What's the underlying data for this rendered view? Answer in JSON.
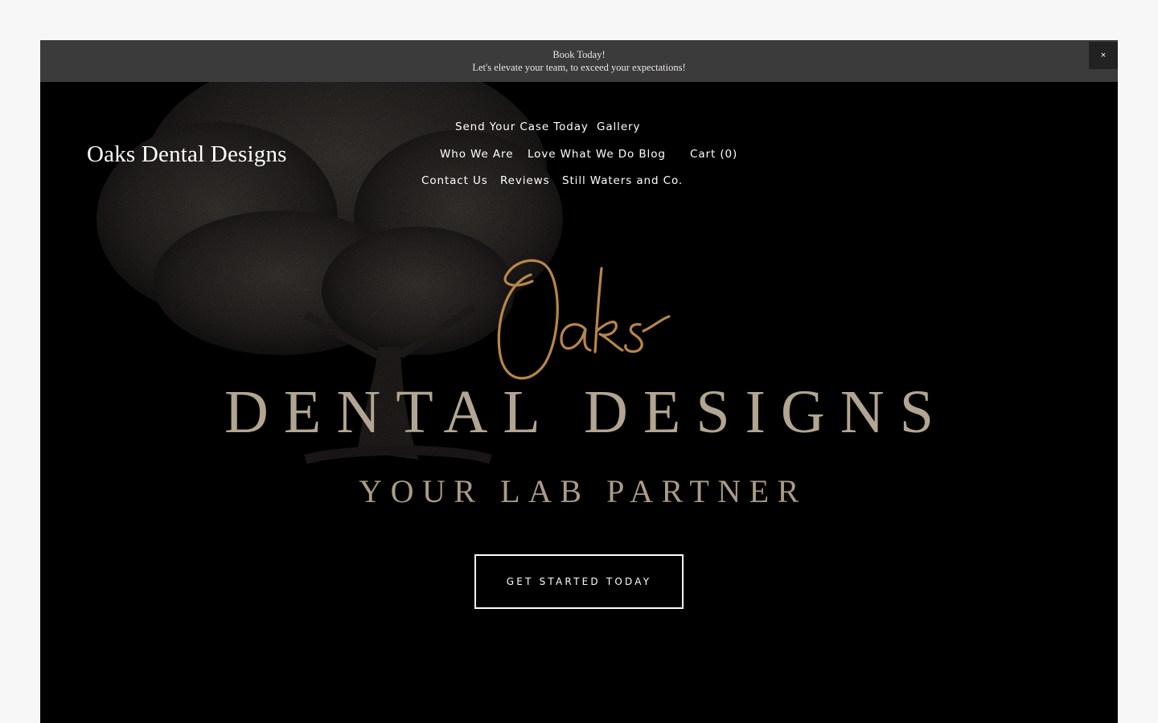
{
  "announcement": {
    "line1": "Book Today!",
    "line2": "Let's elevate your team, to exceed your expectations!",
    "close_label": "×"
  },
  "header": {
    "site_title": "Oaks Dental Designs",
    "nav": {
      "send_case": "Send Your Case Today",
      "gallery": "Gallery",
      "who_we_are": "Who We Are",
      "blog": "Love What We Do Blog",
      "cart": "Cart (0)",
      "contact": "Contact Us",
      "reviews": "Reviews",
      "still_waters": "Still Waters and Co."
    }
  },
  "hero": {
    "logo_script": "Oaks",
    "logo_main": "DENTAL DESIGNS",
    "tagline": "YOUR LAB PARTNER",
    "cta_label": "GET STARTED TODAY"
  },
  "colors": {
    "page_bg": "#f7f7f8",
    "hero_bg": "#000000",
    "announcement_bg": "#3b3b3b",
    "gold_script": "#b8864a",
    "logo_text": "#b2a591"
  },
  "icons": {
    "close": "close-icon",
    "tree": "oak-tree-illustration"
  }
}
